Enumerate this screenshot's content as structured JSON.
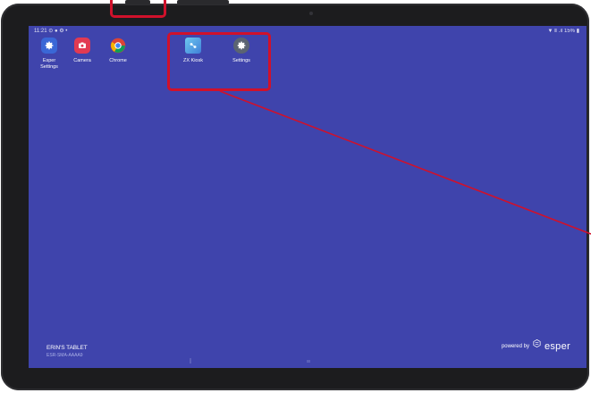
{
  "status_bar": {
    "time": "11:21",
    "left_icons": "⊙ ● ⚙ •",
    "right_status": "▼ Ⅱ .ıl 15% ▮"
  },
  "apps": [
    {
      "label_line1": "Esper",
      "label_line2": "Settings",
      "icon": "gear-icon"
    },
    {
      "label_line1": "Camera",
      "label_line2": "",
      "icon": "camera-icon"
    },
    {
      "label_line1": "Chrome",
      "label_line2": "",
      "icon": "chrome-icon"
    },
    {
      "label_line1": "ZX Kiosk",
      "label_line2": "",
      "icon": "zx-kiosk-icon"
    },
    {
      "label_line1": "Settings",
      "label_line2": "",
      "icon": "settings-gear-icon"
    }
  ],
  "device": {
    "name": "ERIN'S TABLET",
    "serial": "ESR-SMA-AAAA9"
  },
  "footer": {
    "powered_by": "powered by",
    "brand": "esper"
  },
  "colors": {
    "wallpaper": "#3f44ac",
    "highlight": "#d0112b",
    "bezel": "#1c1c1e"
  }
}
